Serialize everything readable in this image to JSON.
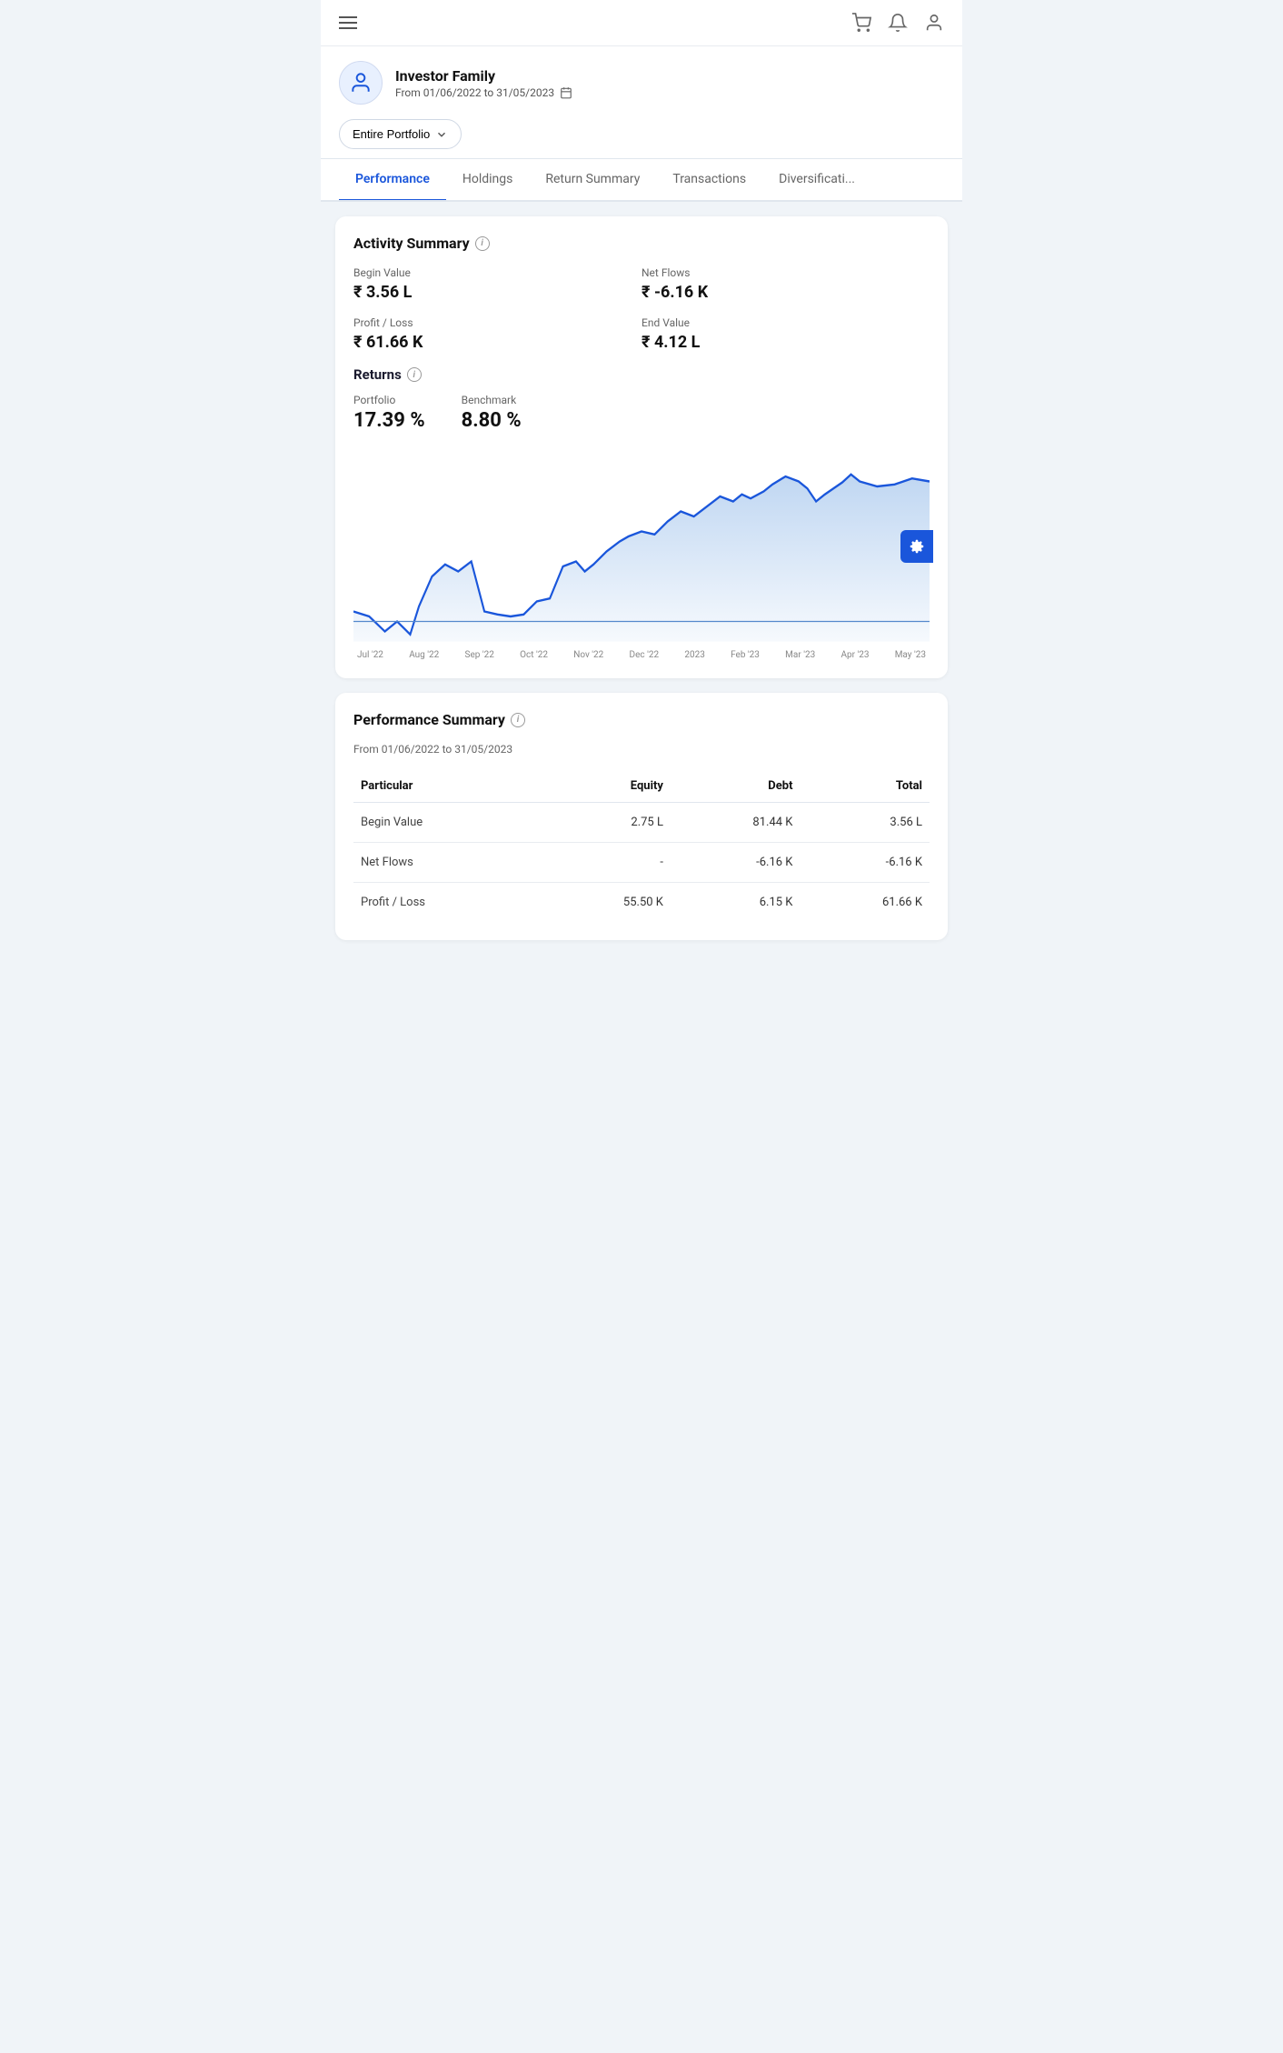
{
  "header": {
    "hamburger_label": "Menu"
  },
  "profile": {
    "name": "Investor Family",
    "date_range": "From 01/06/2022 to 31/05/2023"
  },
  "portfolio_selector": {
    "label": "Entire Portfolio"
  },
  "tabs": [
    {
      "id": "performance",
      "label": "Performance",
      "active": true
    },
    {
      "id": "holdings",
      "label": "Holdings",
      "active": false
    },
    {
      "id": "return-summary",
      "label": "Return Summary",
      "active": false
    },
    {
      "id": "transactions",
      "label": "Transactions",
      "active": false
    },
    {
      "id": "diversification",
      "label": "Diversificati...",
      "active": false
    }
  ],
  "activity_summary": {
    "title": "Activity Summary",
    "metrics": [
      {
        "label": "Begin Value",
        "value": "₹ 3.56 L"
      },
      {
        "label": "Net Flows",
        "value": "₹ -6.16 K"
      },
      {
        "label": "Profit / Loss",
        "value": "₹ 61.66 K"
      },
      {
        "label": "End Value",
        "value": "₹ 4.12 L"
      }
    ]
  },
  "returns": {
    "title": "Returns",
    "items": [
      {
        "label": "Portfolio",
        "value": "17.39 %"
      },
      {
        "label": "Benchmark",
        "value": "8.80 %"
      }
    ]
  },
  "chart": {
    "x_labels": [
      "Jul '22",
      "Aug '22",
      "Sep '22",
      "Oct '22",
      "Nov '22",
      "Dec '22",
      "2023",
      "Feb '23",
      "Mar '23",
      "Apr '23",
      "May '23"
    ]
  },
  "performance_summary": {
    "title": "Performance Summary",
    "date_range": "From 01/06/2022 to 31/05/2023",
    "columns": [
      "Particular",
      "Equity",
      "Debt",
      "Total"
    ],
    "rows": [
      {
        "particular": "Begin Value",
        "equity": "2.75 L",
        "debt": "81.44 K",
        "total": "3.56 L"
      },
      {
        "particular": "Net Flows",
        "equity": "-",
        "debt": "-6.16 K",
        "total": "-6.16 K"
      },
      {
        "particular": "Profit / Loss",
        "equity": "55.50 K",
        "debt": "6.15 K",
        "total": "61.66 K"
      }
    ]
  }
}
